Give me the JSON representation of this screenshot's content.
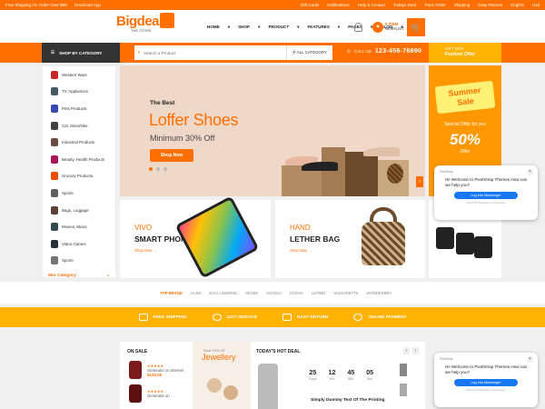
{
  "topbar": {
    "left_links": [
      "Free Shipping On Order Over $99",
      "Download App"
    ],
    "right_links": [
      "Gift Cards",
      "Notifications",
      "Help & Contact",
      "Todays Deal",
      "Track Order",
      "Shipping",
      "Easy Returns",
      "English",
      "Usd"
    ]
  },
  "header": {
    "logo_text": "Bigdeal",
    "logo_sub": "THE STORE",
    "nav": [
      "HOME",
      "SHOP",
      "PRODUCT",
      "FEATURES",
      "PAGES",
      "BLOG"
    ],
    "wishlist_count": "0 ITEM",
    "wishlist_label": "WISHLIST"
  },
  "searchbar": {
    "shop_by_category": "SHOP BY CATEGORY",
    "placeholder": "Search a Product",
    "category_select": "ALL CATEGORY",
    "call_label": "CALL US",
    "phone": "123-456-76890",
    "gift_label": "GIFT BOX",
    "gift_sub": "Festivel Offer"
  },
  "sidebar": {
    "items": [
      {
        "label": "Western Ware",
        "color": "#c62828"
      },
      {
        "label": "TV, Appliances",
        "color": "#455a64"
      },
      {
        "label": "Pets Products",
        "color": "#3949ab"
      },
      {
        "label": "Car, Motorbike",
        "color": "#424242"
      },
      {
        "label": "Industrial Products",
        "color": "#6d4c41"
      },
      {
        "label": "Beauty, Health Products",
        "color": "#ad1457"
      },
      {
        "label": "Grocery Products",
        "color": "#e65100"
      },
      {
        "label": "Sports",
        "color": "#616161"
      },
      {
        "label": "Bags, Luggage",
        "color": "#5d4037"
      },
      {
        "label": "Movies, Music",
        "color": "#37474f"
      },
      {
        "label": "Video Games",
        "color": "#263238"
      },
      {
        "label": "Sports",
        "color": "#757575"
      }
    ],
    "more": "Mor Category"
  },
  "hero": {
    "pre": "The Best",
    "title": "Loffer Shoes",
    "subtitle": "Minimum 30% Off",
    "button": "Shop Now"
  },
  "summer": {
    "title_line1": "Summer",
    "title_line2": "Sale",
    "special": "Special Offer for you",
    "percent": "50%",
    "offer": "Offer"
  },
  "banners": [
    {
      "brand": "VIVO",
      "name": "SMART PHONE",
      "shop": "Shop Now →"
    },
    {
      "brand": "HAND",
      "name": "LETHER BAG",
      "shop": "Shop Now →"
    }
  ],
  "brands": {
    "label": "TOP BRAND",
    "items": [
      "ACER",
      "BACI LINGERIE",
      "GEXBS",
      "IOLODO",
      "OYSHO",
      "ULTIMO",
      "VASSARETTE",
      "WONDERBRA"
    ]
  },
  "features": [
    "FREE SHIPPING",
    "24X7 SERVICE",
    "EASY RETURN",
    "ONLINE PAYMENT"
  ],
  "onsale": {
    "title": "ON SALE",
    "items": [
      {
        "name": "Generator on Internet",
        "price": "$133.00"
      },
      {
        "name": "Generator on",
        "price": ""
      }
    ]
  },
  "jewellery": {
    "pre": "Save 10% Off",
    "title": "Jewellery"
  },
  "hotdeal": {
    "title": "TODAY'S HOT DEAL",
    "countdown": [
      {
        "v": "25",
        "l": "Days"
      },
      {
        "v": "12",
        "l": "Hrs"
      },
      {
        "v": "45",
        "l": "Min"
      },
      {
        "v": "05",
        "l": "Sec"
      }
    ],
    "product": "Simply Dummy Text Of The Printing"
  },
  "chat": {
    "header": "PixelStrap",
    "message": "Hi! Welcome to PixelStrap Themes How can we help you?",
    "button": "Log into Messenger",
    "footer": "Chat with PixelStrap in Messenger"
  }
}
